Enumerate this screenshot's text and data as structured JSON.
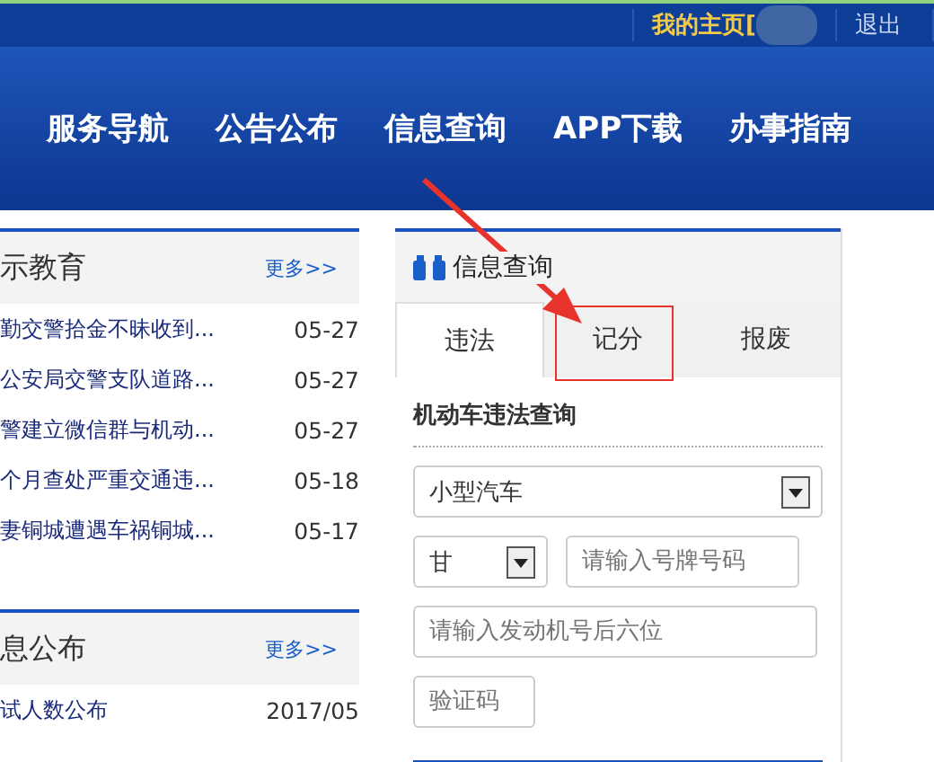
{
  "top_bar": {
    "home_link": "我的主页[",
    "logout": "退出"
  },
  "nav": [
    "服务导航",
    "公告公布",
    "信息查询",
    "APP下载",
    "办事指南"
  ],
  "panels": [
    {
      "title": "示教育",
      "more": "更多>>",
      "rows": [
        {
          "title": "勤交警拾金不昧收到...",
          "date": "05-27"
        },
        {
          "title": "公安局交警支队道路...",
          "date": "05-27"
        },
        {
          "title": "警建立微信群与机动...",
          "date": "05-27"
        },
        {
          "title": "个月查处严重交通违...",
          "date": "05-18"
        },
        {
          "title": "妻铜城遭遇车祸铜城...",
          "date": "05-17"
        }
      ]
    },
    {
      "title": "息公布",
      "more": "更多>>",
      "rows": [
        {
          "title": "试人数公布",
          "date": "2017/05"
        }
      ]
    }
  ],
  "query": {
    "title": "信息查询",
    "tabs": [
      {
        "label": "违法",
        "selected": true,
        "annotated": false
      },
      {
        "label": "记分",
        "selected": false,
        "annotated": true
      },
      {
        "label": "报废",
        "selected": false,
        "annotated": false
      }
    ],
    "form_title": "机动车违法查询",
    "vehicle_type": "小型汽车",
    "province": "甘",
    "plate": {
      "placeholder": "请输入号牌号码"
    },
    "engine": {
      "placeholder": "请输入发动机号后六位"
    },
    "captcha": {
      "placeholder": "验证码"
    }
  }
}
